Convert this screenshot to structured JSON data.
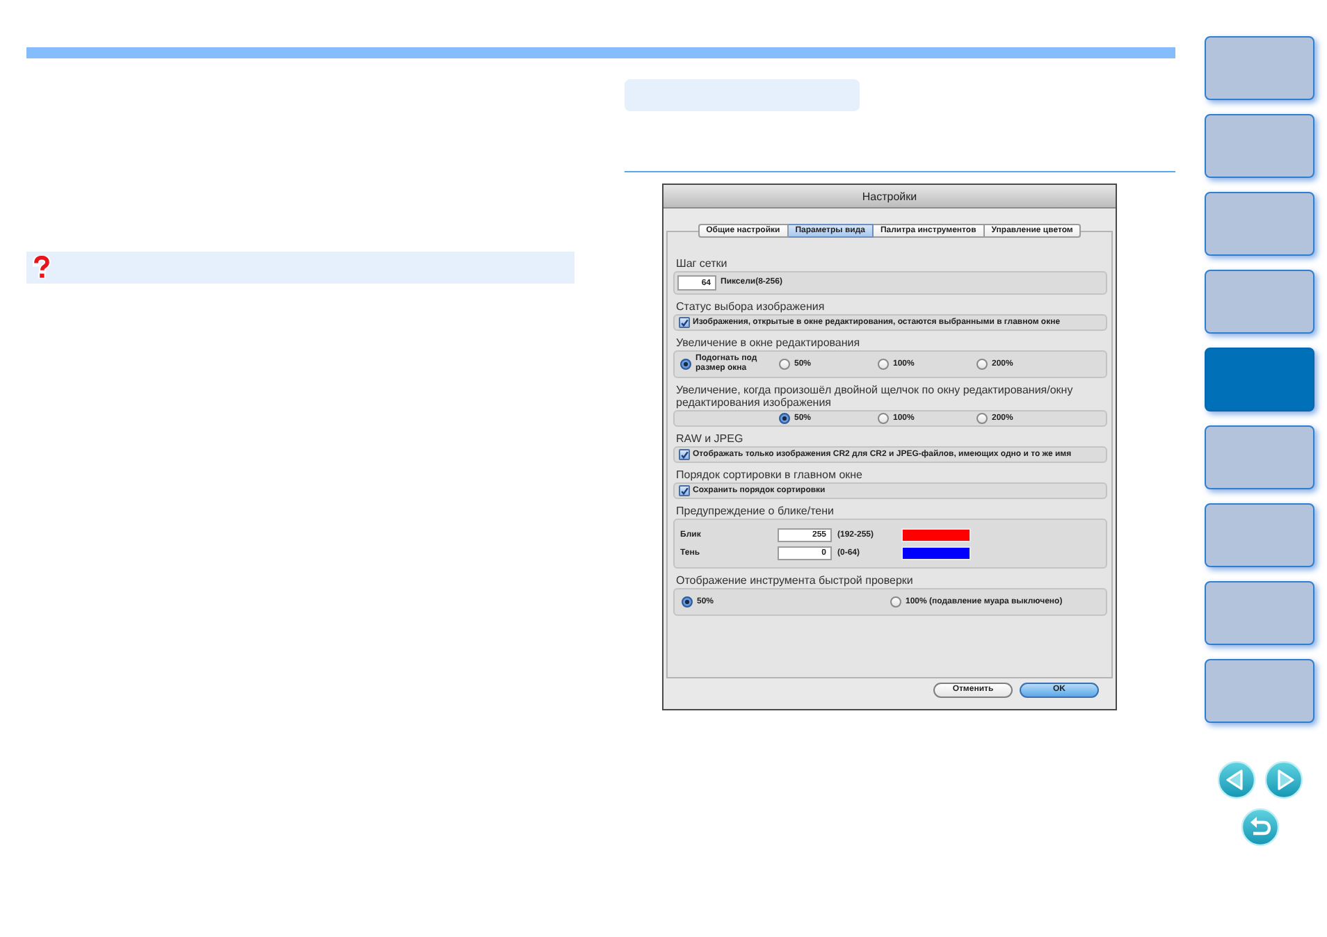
{
  "dialog": {
    "title": "Настройки",
    "tabs": [
      {
        "label": "Общие настройки",
        "selected": false
      },
      {
        "label": "Параметры вида",
        "selected": true
      },
      {
        "label": "Палитра инструментов",
        "selected": false
      },
      {
        "label": "Управление цветом",
        "selected": false
      }
    ],
    "sections": [
      {
        "heading": "Шаг сетки",
        "kind": "number",
        "value": "64",
        "note": "Пиксели(8-256)"
      },
      {
        "heading": "Статус выбора изображения",
        "kind": "checkbox",
        "label": "Изображения, открытые в окне редактирования, остаются выбранными в главном окне",
        "checked": true
      },
      {
        "heading": "Увеличение в окне редактирования",
        "kind": "radios",
        "options": [
          {
            "label": "Подогнать под размер окна",
            "selected": true
          },
          {
            "label": "50%",
            "selected": false
          },
          {
            "label": "100%",
            "selected": false
          },
          {
            "label": "200%",
            "selected": false
          }
        ]
      },
      {
        "heading": "Увеличение, когда произошёл двойной щелчок по окну редактирования/окну редактирования изображения",
        "kind": "radios",
        "options": [
          {
            "label": "50%",
            "selected": true
          },
          {
            "label": "100%",
            "selected": false
          },
          {
            "label": "200%",
            "selected": false
          }
        ]
      },
      {
        "heading": "RAW и JPEG",
        "kind": "checkbox",
        "label": "Отображать только изображения CR2 для CR2 и JPEG-файлов, имеющих одно и то же имя",
        "checked": true
      },
      {
        "heading": "Порядок сортировки в главном окне",
        "kind": "checkbox",
        "label": "Сохранить порядок сортировки",
        "checked": true
      },
      {
        "heading": "Предупреждение о блике/тени",
        "kind": "levels",
        "rows": [
          {
            "label": "Блик",
            "value": "255",
            "range": "(192-255)",
            "color": "#ff0000"
          },
          {
            "label": "Тень",
            "value": "0",
            "range": "(0-64)",
            "color": "#0000ff"
          }
        ]
      },
      {
        "heading": "Отображение инструмента быстрой проверки",
        "kind": "radios",
        "options": [
          {
            "label": "50%",
            "selected": true
          },
          {
            "label": "100% (подавление муара выключено)",
            "selected": false
          }
        ]
      }
    ],
    "buttons": [
      {
        "label": "Отменить",
        "default": false
      },
      {
        "label": "OK",
        "default": true
      }
    ]
  },
  "sidebar": {
    "tabs": [
      {
        "selected": false
      },
      {
        "selected": false
      },
      {
        "selected": false
      },
      {
        "selected": false
      },
      {
        "selected": true
      },
      {
        "selected": false
      },
      {
        "selected": false
      },
      {
        "selected": false
      },
      {
        "selected": false
      }
    ]
  }
}
